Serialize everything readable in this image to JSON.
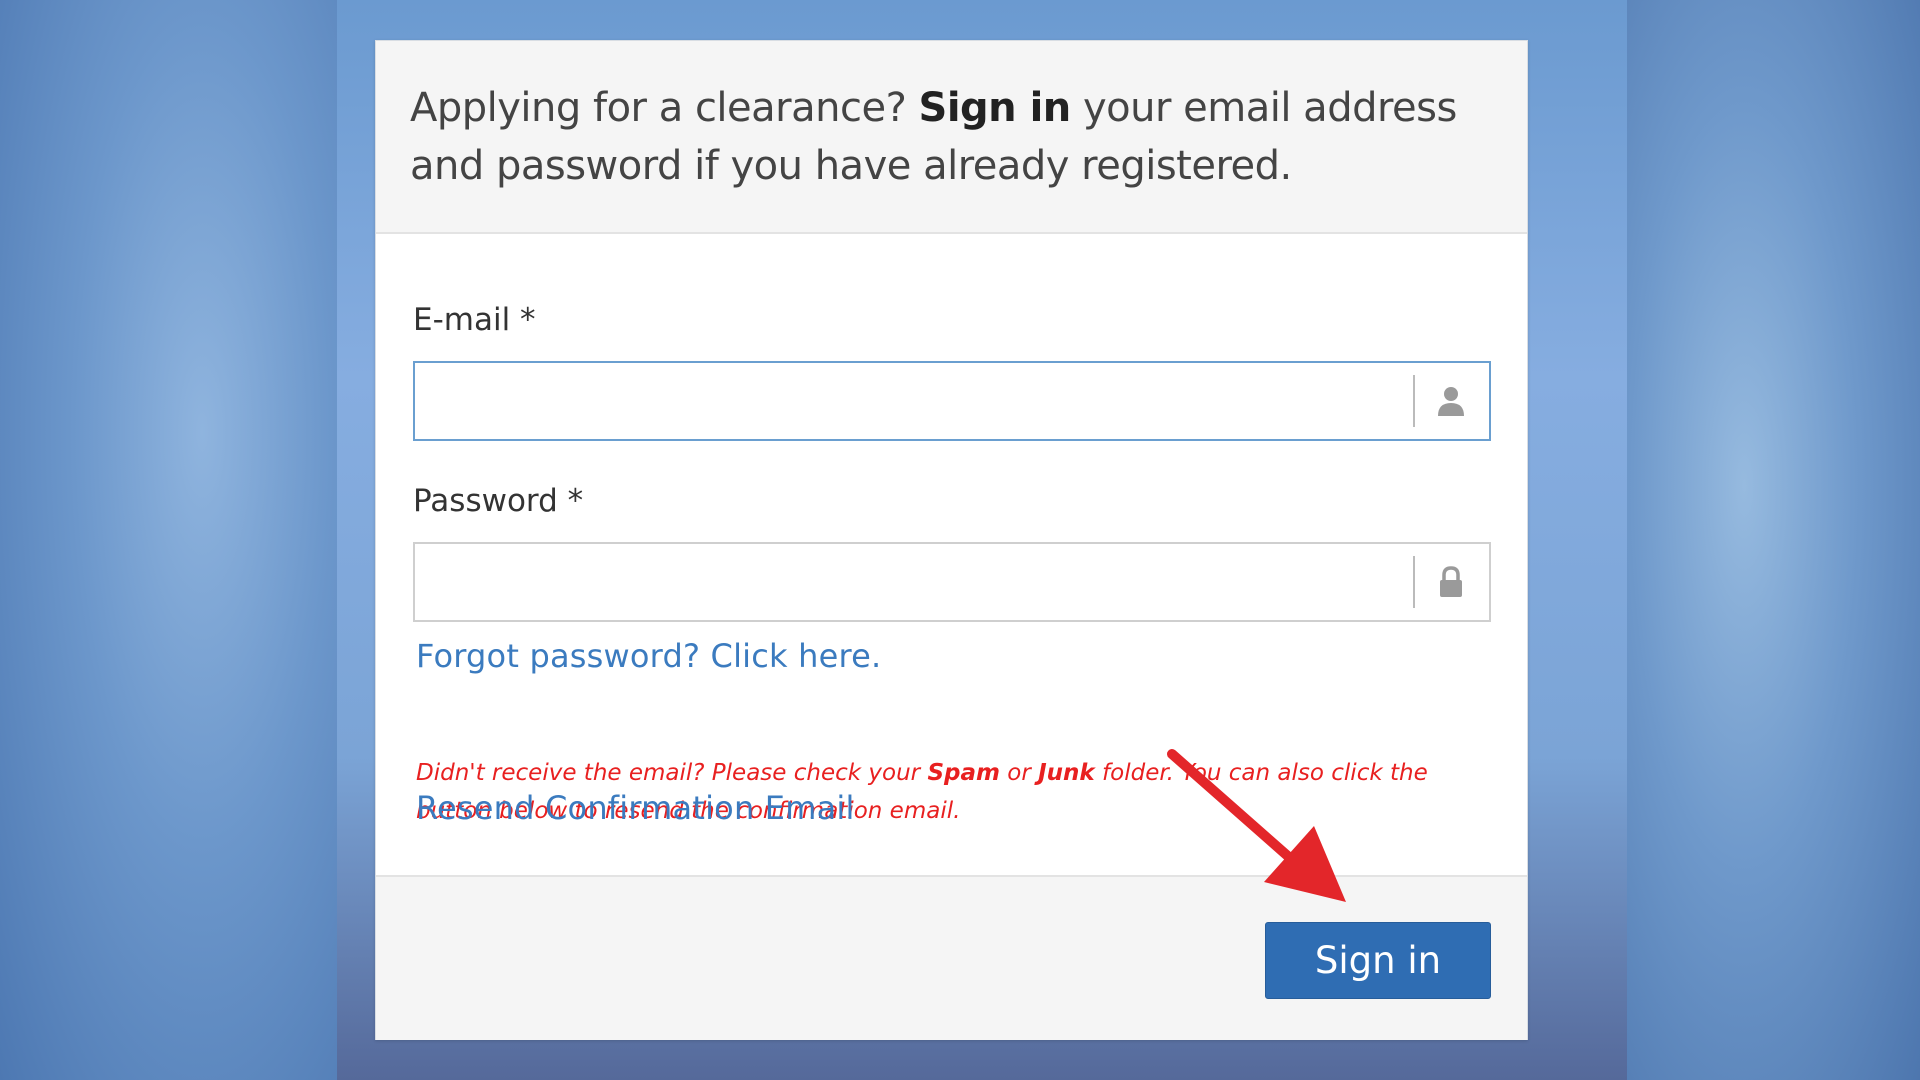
{
  "header": {
    "prefix": "Applying for a clearance?",
    "bold": "Sign in",
    "suffix": "your email address and password if you have already registered."
  },
  "email": {
    "label": "E-mail *",
    "value": "",
    "icon": "user-icon"
  },
  "password": {
    "label": "Password *",
    "value": "",
    "icon": "lock-icon"
  },
  "forgot_link": "Forgot password? Click here.",
  "notice": {
    "part1": "Didn't receive the email? Please check your",
    "spam": "Spam",
    "or": "or",
    "junk": "Junk",
    "part2": "folder. You can also click the button below to resend the confirmation email."
  },
  "resend_link": "Resend Confirmation Email",
  "signin_button": "Sign in",
  "colors": {
    "button": "#2f6db3",
    "link": "#3b7bbf",
    "notice": "#e82020",
    "arrow": "#e3262a"
  }
}
